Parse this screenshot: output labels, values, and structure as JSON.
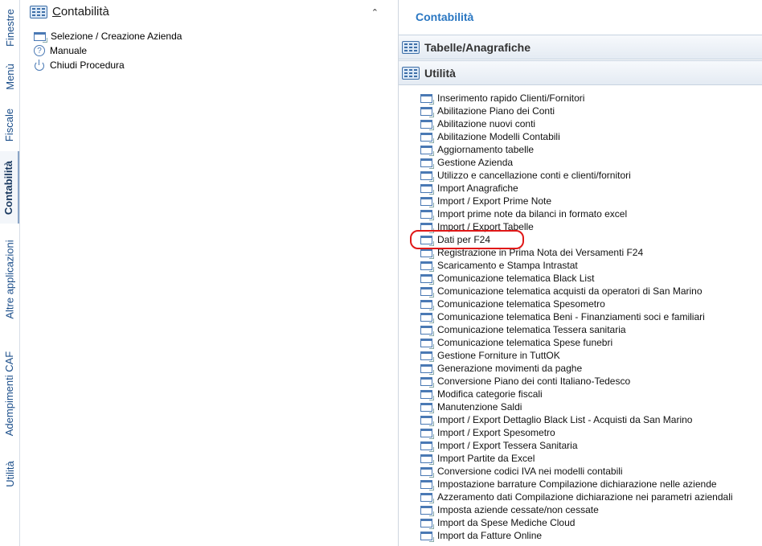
{
  "tabs": [
    "Finestre",
    "Menù",
    "Fiscale",
    "Contabilità",
    "Altre applicazioni",
    "Adempimenti CAF",
    "Utilità"
  ],
  "active_tab": "Contabilità",
  "left_panel": {
    "title_first": "C",
    "title_rest": "ontabilità",
    "collapse_glyph": "⌃",
    "items": [
      {
        "label": "Selezione / Creazione Azienda",
        "icon": "window-icon"
      },
      {
        "label": "Manuale",
        "icon": "help-icon"
      },
      {
        "label": "Chiudi Procedura",
        "icon": "power-icon"
      }
    ]
  },
  "right_panel": {
    "title": "Contabilità",
    "sections": [
      {
        "title": "Tabelle/Anagrafiche"
      },
      {
        "title": "Utilità"
      }
    ],
    "items": [
      "Inserimento rapido Clienti/Fornitori",
      "Abilitazione Piano dei Conti",
      "Abilitazione nuovi conti",
      "Abilitazione Modelli Contabili",
      "Aggiornamento tabelle",
      "Gestione Azienda",
      "Utilizzo e cancellazione conti e clienti/fornitori",
      "Import Anagrafiche",
      "Import / Export Prime Note",
      "Import prime note da bilanci in formato excel",
      "Import / Export Tabelle",
      "Dati per F24",
      "Registrazione in Prima Nota dei Versamenti F24",
      "Scaricamento e Stampa Intrastat",
      "Comunicazione telematica Black List",
      "Comunicazione telematica acquisti da operatori di San Marino",
      "Comunicazione telematica Spesometro",
      "Comunicazione telematica Beni - Finanziamenti soci e familiari",
      "Comunicazione telematica Tessera sanitaria",
      "Comunicazione telematica Spese funebri",
      "Gestione Forniture in TuttOK",
      "Generazione movimenti da paghe",
      "Conversione Piano dei conti Italiano-Tedesco",
      "Modifica categorie fiscali",
      "Manutenzione Saldi",
      "Import / Export Dettaglio Black List - Acquisti da San Marino",
      "Import / Export Spesometro",
      "Import / Export Tessera Sanitaria",
      "Import Partite da Excel",
      "Conversione codici IVA nei modelli contabili",
      "Impostazione barrature Compilazione dichiarazione nelle aziende",
      "Azzeramento dati Compilazione dichiarazione nei parametri aziendali",
      "Imposta aziende cessate/non cessate",
      "Import da Spese Mediche Cloud",
      "Import da Fatture Online"
    ],
    "highlighted_item": "Dati per F24"
  },
  "colors": {
    "accent": "#2a77c2",
    "highlight": "#e01818",
    "tab_text": "#1b4e8a"
  }
}
